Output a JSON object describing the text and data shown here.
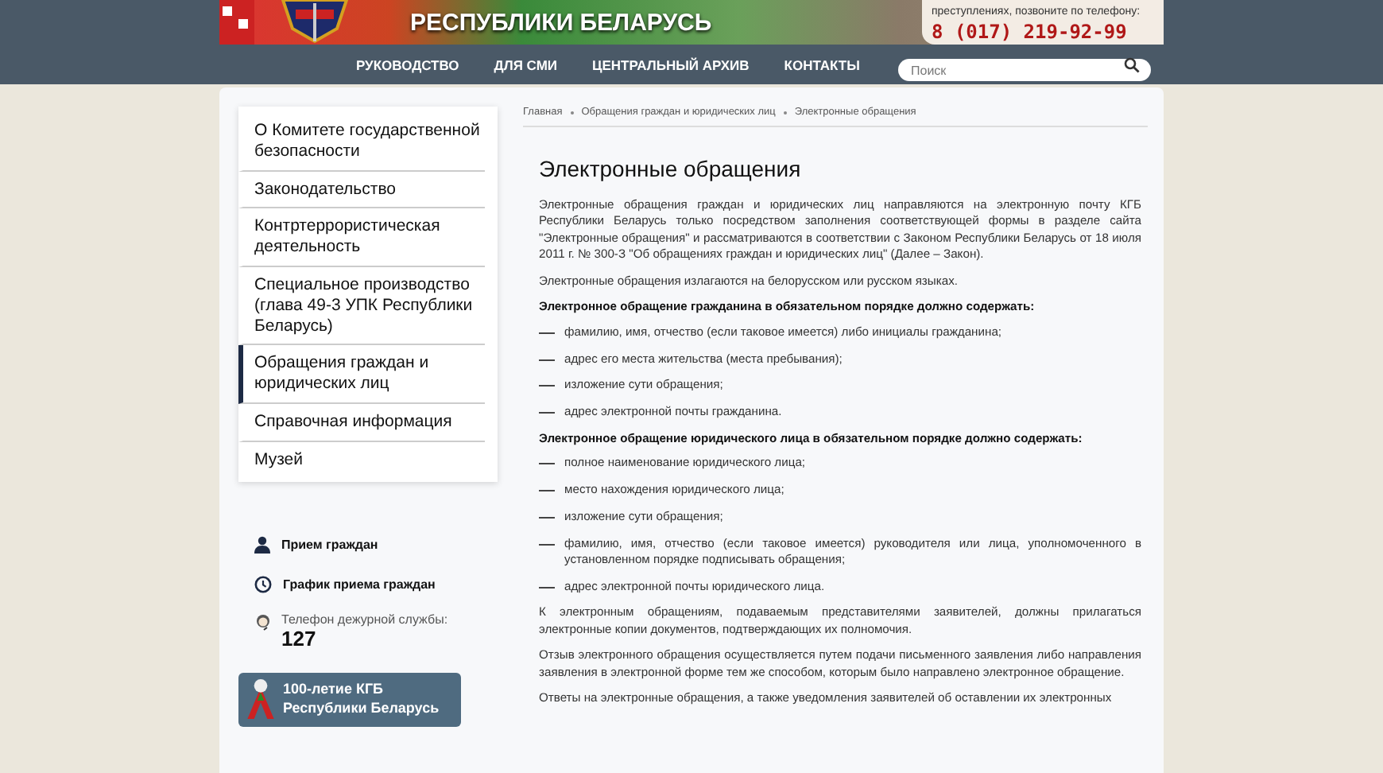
{
  "header": {
    "title": "РЕСПУБЛИКИ БЕЛАРУСЬ",
    "hotline_note": "преступлениях, позвоните по телефону:",
    "hotline_phone": "8 (017) 219-92-99"
  },
  "nav": [
    {
      "label": "РУКОВОДСТВО"
    },
    {
      "label": "ДЛЯ СМИ"
    },
    {
      "label": "ЦЕНТРАЛЬНЫЙ АРХИВ"
    },
    {
      "label": "КОНТАКТЫ"
    }
  ],
  "search": {
    "placeholder": "Поиск"
  },
  "sidebar": {
    "items": [
      {
        "label": "О Комитете государственной безопасности",
        "selected": false
      },
      {
        "label": "Законодательство",
        "selected": false
      },
      {
        "label": "Контртеррористическая деятельность",
        "selected": false
      },
      {
        "label": "Специальное производство (глава 49-3 УПК Республики Беларусь)",
        "selected": false
      },
      {
        "label": "Обращения граждан и юридических лиц",
        "selected": true
      },
      {
        "label": "Справочная информация",
        "selected": false
      },
      {
        "label": "Музей",
        "selected": false
      }
    ],
    "links": [
      {
        "kind": "person",
        "label": "Прием граждан"
      },
      {
        "kind": "clock",
        "label": "График приема граждан"
      }
    ],
    "duty_phone": {
      "label": "Телефон дежурной службы:",
      "number": "127"
    },
    "banner": {
      "line_1": "100-летие КГБ",
      "line_2": "Республики Беларусь"
    }
  },
  "breadcrumbs": [
    "Главная",
    "Обращения граждан и юридических лиц",
    "Электронные обращения"
  ],
  "content": {
    "title": "Электронные обращения",
    "blocks": [
      {
        "kind": "para",
        "text": "Электронные обращения граждан и юридических лиц направляются на электронную почту КГБ Республики Беларусь только посредством заполнения соответствующей формы в разделе сайта \"Электронные обращения\" и рассматриваются в соответствии с Законом Республики Беларусь от 18 июля 2011 г. № 300-З \"Об обращениях граждан и юридических лиц\" (Далее – Закон)."
      },
      {
        "kind": "para",
        "text": "Электронные обращения излагаются на белорусском или русском языках."
      },
      {
        "kind": "heading",
        "text": "Электронное обращение гражданина в обязательном порядке должно содержать:"
      },
      {
        "kind": "item",
        "text": "фамилию, имя, отчество (если таковое имеется) либо инициалы гражданина;"
      },
      {
        "kind": "item",
        "text": "адрес его места жительства (места пребывания);"
      },
      {
        "kind": "item",
        "text": "изложение сути обращения;"
      },
      {
        "kind": "item",
        "text": "адрес электронной почты гражданина."
      },
      {
        "kind": "heading",
        "text": "Электронное обращение юридического лица в обязательном порядке должно содержать:"
      },
      {
        "kind": "item",
        "text": "полное наименование юридического лица;"
      },
      {
        "kind": "item",
        "text": "место нахождения юридического лица;"
      },
      {
        "kind": "item",
        "text": "изложение сути обращения;"
      },
      {
        "kind": "item",
        "text": "фамилию, имя, отчество (если таковое имеется) руководителя или лица, уполномоченного в установленном порядке подписывать обращения;"
      },
      {
        "kind": "item",
        "text": "адрес электронной почты юридического лица."
      },
      {
        "kind": "para",
        "text": "К электронным обращениям, подаваемым представителями заявителей, должны прилагаться электронные копии документов, подтверждающих их полномочия."
      },
      {
        "kind": "para",
        "text": "Отзыв электронного обращения осуществляется путем подачи письменного заявления либо направления заявления в электронной форме тем же способом, которым было направлено электронное обращение."
      },
      {
        "kind": "para",
        "text": "Ответы на электронные обращения, а также уведомления заявителей об оставлении их электронных"
      }
    ]
  }
}
